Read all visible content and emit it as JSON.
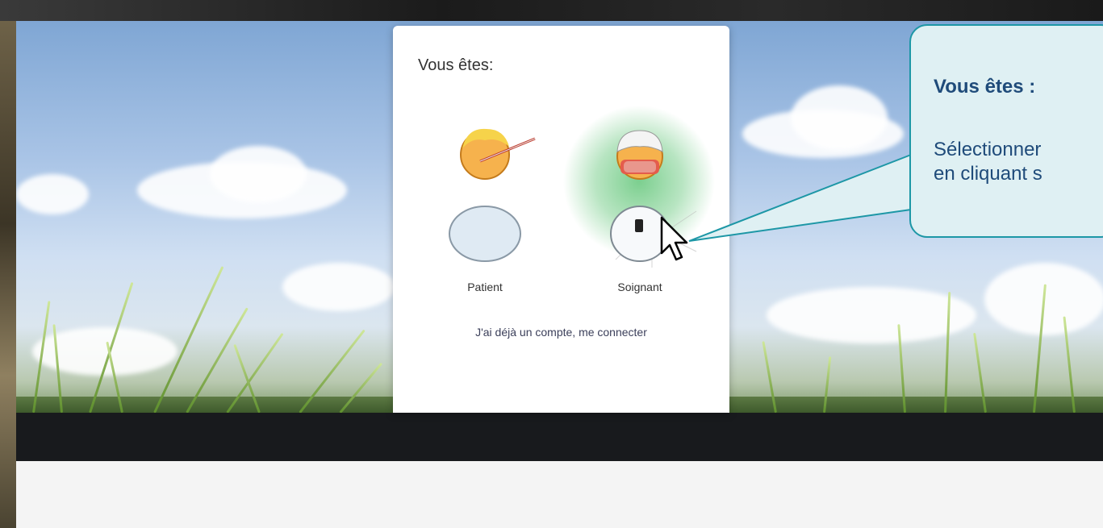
{
  "modal": {
    "title": "Vous êtes:",
    "options": [
      {
        "label": "Patient",
        "icon": "patient-icon"
      },
      {
        "label": "Soignant",
        "icon": "caregiver-icon",
        "highlighted": true
      }
    ],
    "login_link": "J'ai déjà un compte, me connecter"
  },
  "callout": {
    "title": "Vous êtes :",
    "line1": "Sélectionner",
    "line2": "en cliquant s"
  },
  "colors": {
    "callout_border": "#1d97a6",
    "callout_bg": "#dff0f3",
    "callout_text": "#1f4b7a",
    "dark_bar": "#181a1d",
    "highlight_glow": "#7ccf8f"
  }
}
